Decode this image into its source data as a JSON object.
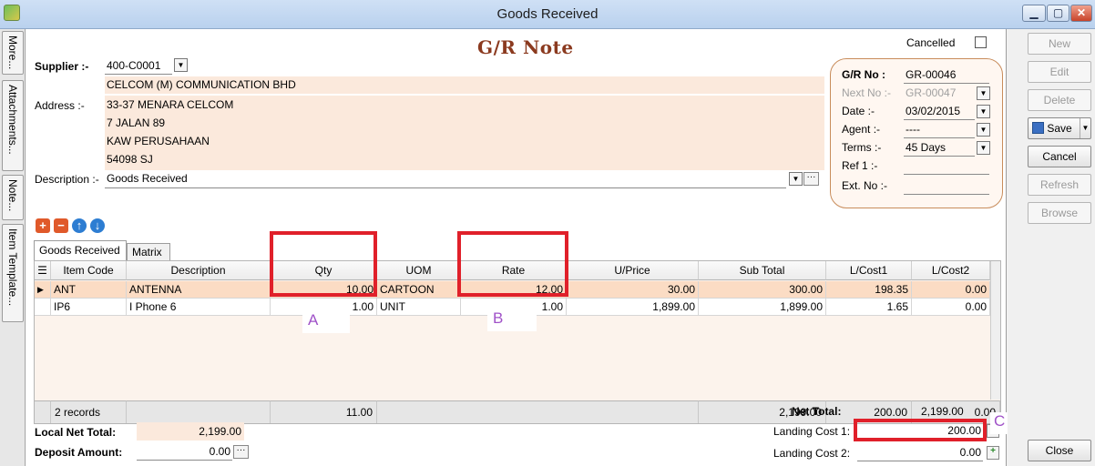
{
  "window": {
    "title": "Goods Received",
    "minimize": "▁",
    "maximize": "▢",
    "close": "✕"
  },
  "side_tabs": [
    "More...",
    "Attachments...",
    "Note...",
    "Item Template..."
  ],
  "header": {
    "title": "G/R Note",
    "cancelled_label": "Cancelled",
    "supplier_label": "Supplier :-",
    "supplier_code": "400-C0001",
    "supplier_name": "CELCOM (M) COMMUNICATION BHD",
    "address_label": "Address :-",
    "address": [
      "33-37 MENARA CELCOM",
      "7 JALAN 89",
      "KAW PERUSAHAAN",
      "54098 SJ"
    ],
    "description_label": "Description :-",
    "description_value": "Goods Received"
  },
  "gr_box": {
    "no_label": "G/R No :",
    "no_value": "GR-00046",
    "next_label": "Next No :-",
    "next_value": "GR-00047",
    "date_label": "Date :-",
    "date_value": "03/02/2015",
    "agent_label": "Agent :-",
    "agent_value": "----",
    "terms_label": "Terms :-",
    "terms_value": "45 Days",
    "ref1_label": "Ref 1 :-",
    "ref1_value": "",
    "ext_label": "Ext. No :-",
    "ext_value": ""
  },
  "tabs": [
    "Goods Received",
    "Matrix"
  ],
  "grid": {
    "columns": [
      "Item Code",
      "Description",
      "Qty",
      "UOM",
      "Rate",
      "U/Price",
      "Sub Total",
      "L/Cost1",
      "L/Cost2"
    ],
    "rows": [
      [
        "ANT",
        "ANTENNA",
        "10.00",
        "CARTOON",
        "12.00",
        "30.00",
        "300.00",
        "198.35",
        "0.00"
      ],
      [
        "IP6",
        "I Phone 6",
        "1.00",
        "UNIT",
        "1.00",
        "1,899.00",
        "1,899.00",
        "1.65",
        "0.00"
      ]
    ],
    "footer": {
      "records": "2 records",
      "qty": "11.00",
      "sub_total": "2,199.00",
      "l_cost1": "200.00",
      "l_cost2": "0.00"
    }
  },
  "annotations": {
    "a": "A",
    "b": "B",
    "c": "C"
  },
  "totals": {
    "net_total_label": "Net Total:",
    "net_total_value": "2,199.00",
    "landing1_label": "Landing Cost 1:",
    "landing1_value": "200.00",
    "landing2_label": "Landing Cost 2:",
    "landing2_value": "0.00",
    "local_net_label": "Local Net Total:",
    "local_net_value": "2,199.00",
    "deposit_label": "Deposit Amount:",
    "deposit_value": "0.00"
  },
  "sidebar": {
    "new": "New",
    "edit": "Edit",
    "delete": "Delete",
    "save": "Save",
    "cancel": "Cancel",
    "refresh": "Refresh",
    "browse": "Browse",
    "close": "Close"
  },
  "colors": {
    "accent_red": "#e0202a",
    "title_brown": "#8b3a1f",
    "annotation": "#a052c8"
  }
}
